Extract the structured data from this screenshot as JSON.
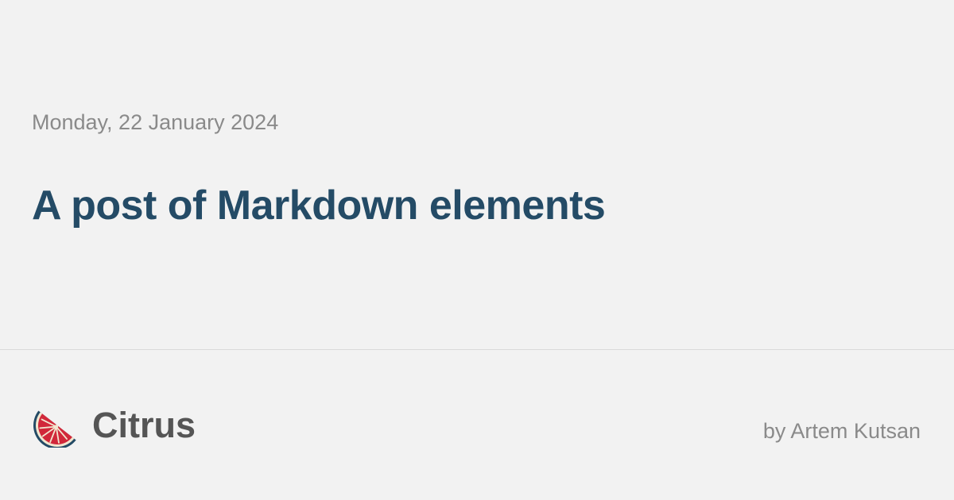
{
  "post": {
    "date": "Monday, 22 January 2024",
    "title": "A post of Markdown elements"
  },
  "site": {
    "name": "Citrus",
    "logo_icon": "grapefruit-slice-icon",
    "byline": "by Artem Kutsan"
  },
  "colors": {
    "background": "#f2f2f2",
    "title": "#244b66",
    "muted_text": "#8a8a8a",
    "logo_text": "#555555",
    "divider": "#d9d9d9",
    "fruit_flesh": "#d1283a",
    "fruit_peel": "#244b66",
    "fruit_pith": "#f2e7d0"
  }
}
